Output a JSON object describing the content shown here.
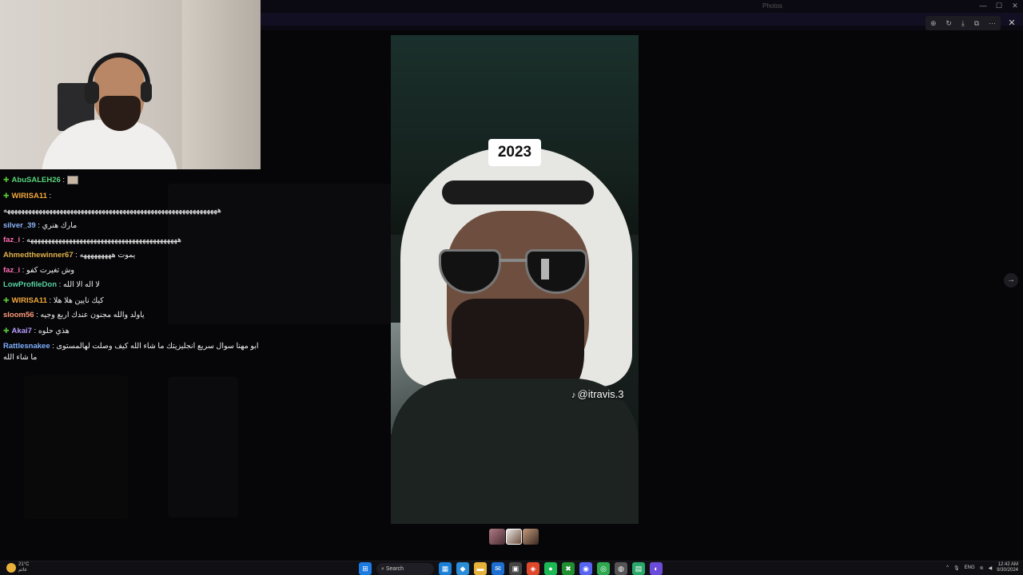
{
  "window": {
    "tab_title": "Photos",
    "controls": [
      "—",
      "☐",
      "✕"
    ],
    "viewer_tools": [
      "⊕",
      "↻",
      "⤓",
      "⧉",
      "⋯"
    ],
    "close": "✕",
    "next": "→"
  },
  "chat": {
    "messages": [
      {
        "user": "AbuSALEH26",
        "color": "#57d37a",
        "badge": true,
        "text": "",
        "emote": true
      },
      {
        "user": "WIRISA11",
        "color": "#f2a93b",
        "badge": true,
        "text": ""
      },
      {
        "user": "",
        "color": "#ffffff",
        "badge": false,
        "text": "هههههههههههههههههههههههههههههههههههههههههههههههههههههههههههههه",
        "raw": true
      },
      {
        "user": "silver_39",
        "color": "#8ab4f8",
        "badge": false,
        "text": "مارك هنري"
      },
      {
        "user": "faz_i",
        "color": "#ff6fb3",
        "badge": false,
        "text": "هههههههههههههههههههههههههههههههههههههههههههه"
      },
      {
        "user": "Ahmedthewinner67",
        "color": "#e0b04a",
        "badge": false,
        "text": "يموت هههههههههه"
      },
      {
        "user": "faz_i",
        "color": "#ff6fb3",
        "badge": false,
        "text": "وش تغيرت كفو"
      },
      {
        "user": "LowProfileDon",
        "color": "#57d3a2",
        "badge": false,
        "text": "لا اله الا الله"
      },
      {
        "user": "WIRISA11",
        "color": "#f2a93b",
        "badge": true,
        "text": "كيك نايين هلا هلا"
      },
      {
        "user": "sloom56",
        "color": "#ff9a7a",
        "badge": false,
        "text": "ياولد والله مجنون عندك اربع وجيه"
      },
      {
        "user": "Akai7",
        "color": "#b89cff",
        "badge": true,
        "text": "هذي حلوه"
      },
      {
        "user": "Rattlesnakee",
        "color": "#7fb0ff",
        "badge": false,
        "text": "ابو مهنا سوال سريع انجليزيتك ما شاء الله كيف وصلت لهالمستوى ما شاء الله",
        "wrap": true
      }
    ]
  },
  "video": {
    "year_label": "2023",
    "handle": "@itravis.3",
    "tiktok_glyph": "♪"
  },
  "taskbar": {
    "weather_temp": "21°C",
    "weather_desc": "غائم",
    "search_label": "Search",
    "apps": [
      {
        "glyph": "▦",
        "color": "#1a7fd8"
      },
      {
        "glyph": "◆",
        "color": "#2b8cd8"
      },
      {
        "glyph": "▬",
        "color": "#e8b23a"
      },
      {
        "glyph": "✉",
        "color": "#1c6fd0"
      },
      {
        "glyph": "▣",
        "color": "#444"
      },
      {
        "glyph": "◈",
        "color": "#e0482c"
      },
      {
        "glyph": "●",
        "color": "#1db954"
      },
      {
        "glyph": "✖",
        "color": "#1f8f2f"
      },
      {
        "glyph": "◉",
        "color": "#5865f2"
      },
      {
        "glyph": "◎",
        "color": "#2fa84f"
      },
      {
        "glyph": "◍",
        "color": "#555"
      },
      {
        "glyph": "▤",
        "color": "#2aa86a"
      },
      {
        "glyph": "◐",
        "color": "#6c4bd8"
      }
    ],
    "lang": "ENG",
    "time": "12:42 AM",
    "date": "9/30/2024"
  }
}
